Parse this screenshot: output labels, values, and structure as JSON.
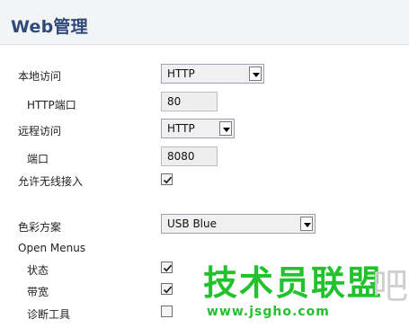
{
  "header": {
    "title": "Web管理"
  },
  "form": {
    "local_access": {
      "label": "本地访问",
      "value": "HTTP"
    },
    "http_port": {
      "label": "HTTP端口",
      "value": "80"
    },
    "remote_access": {
      "label": "远程访问",
      "value": "HTTP"
    },
    "port": {
      "label": "端口",
      "value": "8080"
    },
    "allow_wireless": {
      "label": "允许无线接入",
      "checked": true
    },
    "color_scheme": {
      "label": "色彩方案",
      "value": "USB Blue"
    },
    "open_menus": {
      "label": "Open Menus",
      "items": [
        {
          "label": "状态",
          "checked": true
        },
        {
          "label": "带宽",
          "checked": true
        },
        {
          "label": "诊断工具",
          "checked": false
        }
      ]
    }
  },
  "watermark": {
    "title": "技术员联盟",
    "url": "www.jsgho.com",
    "deco": "吧"
  },
  "colors": {
    "title": "#2f4a7a",
    "watermark": "#22c22c"
  }
}
